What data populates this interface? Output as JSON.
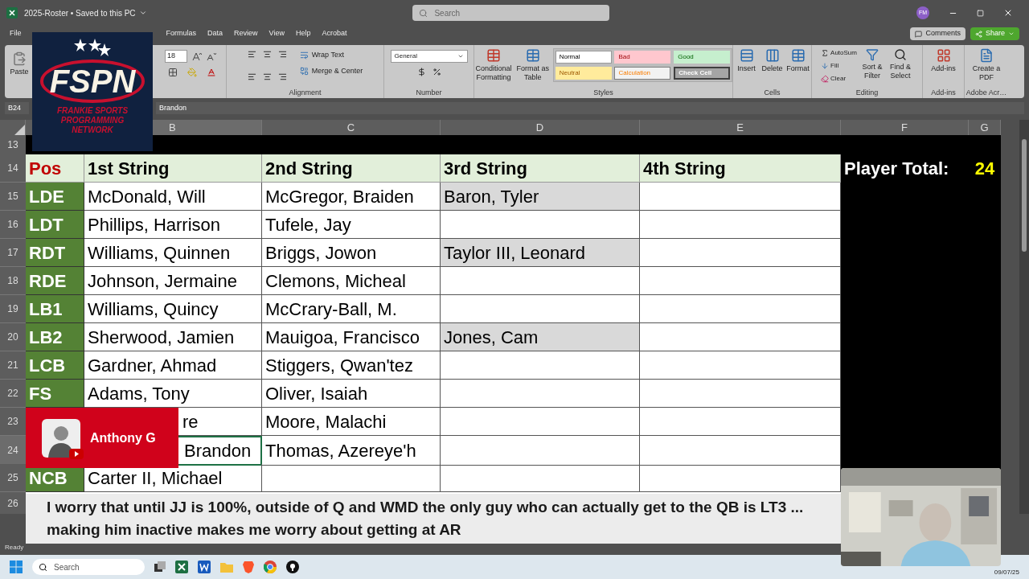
{
  "window": {
    "title": "2025-Roster • Saved to this PC",
    "search_placeholder": "Search",
    "user_initials": "FM"
  },
  "menu_tabs": [
    "File",
    "Formulas",
    "Data",
    "Review",
    "View",
    "Help",
    "Acrobat"
  ],
  "header_buttons": {
    "comments": "Comments",
    "share": "Share"
  },
  "ribbon": {
    "paste": "Paste",
    "font_size": "18",
    "alignment": {
      "wrap": "Wrap Text",
      "merge": "Merge & Center",
      "label": "Alignment"
    },
    "number": {
      "format": "General",
      "label": "Number"
    },
    "styles": {
      "conditional": "Conditional Formatting",
      "format_table": "Format as Table",
      "label": "Styles",
      "cells": [
        {
          "label": "Normal",
          "kind": "normal"
        },
        {
          "label": "Bad",
          "kind": "bad"
        },
        {
          "label": "Good",
          "kind": "good"
        },
        {
          "label": "Neutral",
          "kind": "neutral"
        },
        {
          "label": "Calculation",
          "kind": "calculation"
        },
        {
          "label": "Check Cell",
          "kind": "check"
        }
      ]
    },
    "cells": {
      "buttons": [
        "Insert",
        "Delete",
        "Format"
      ],
      "label": "Cells"
    },
    "editing": {
      "autosum": "AutoSum",
      "fill": "Fill",
      "clear": "Clear",
      "sort": "Sort & Filter",
      "find": "Find & Select",
      "label": "Editing"
    },
    "addins": {
      "button": "Add-ins",
      "label": "Add-ins"
    },
    "adobe": {
      "button": "Create a PDF",
      "label": "Adobe Acr…"
    }
  },
  "formula_bar": {
    "name_box": "B24",
    "value": "Brandon"
  },
  "columns": [
    "B",
    "C",
    "D",
    "E",
    "F",
    "G"
  ],
  "header_row": {
    "num": "14",
    "pos": "Pos",
    "first": "1st String",
    "second": "2nd String",
    "third": "3rd String",
    "fourth": "4th String",
    "total_label": "Player Total:",
    "total": "24"
  },
  "rows": [
    {
      "num": "15",
      "pos": "LDE",
      "first": "McDonald, Will",
      "second": "McGregor, Braiden",
      "third": "Baron, Tyler",
      "selected": false
    },
    {
      "num": "16",
      "pos": "LDT",
      "first": "Phillips, Harrison",
      "second": "Tufele, Jay",
      "selected": false
    },
    {
      "num": "17",
      "pos": "RDT",
      "first": "Williams, Quinnen",
      "second": "Briggs, Jowon",
      "third": "Taylor III, Leonard",
      "selected": false
    },
    {
      "num": "18",
      "pos": "RDE",
      "first": "Johnson, Jermaine",
      "second": "Clemons, Micheal",
      "selected": false
    },
    {
      "num": "19",
      "pos": "LB1",
      "first": "Williams, Quincy",
      "second": "McCrary-Ball, M.",
      "selected": false
    },
    {
      "num": "20",
      "pos": "LB2",
      "first": "Sherwood, Jamien",
      "second": "Mauigoa, Francisco",
      "third": "Jones, Cam",
      "selected": false
    },
    {
      "num": "21",
      "pos": "LCB",
      "first": "Gardner, Ahmad",
      "second": "Stiggers, Qwan'tez",
      "selected": false
    },
    {
      "num": "22",
      "pos": "FS",
      "first": "Adams, Tony",
      "second": "Oliver, Isaiah",
      "selected": false
    },
    {
      "num": "23",
      "first": "re",
      "second": "Moore, Malachi",
      "selected": false
    },
    {
      "num": "24",
      "first": "Brandon",
      "second": "Thomas, Azereye'h",
      "selected": true
    },
    {
      "num": "25",
      "pos": "NCB",
      "first": "Carter II, Michael",
      "selected": false
    }
  ],
  "extra_row_numbers": [
    "13",
    "26"
  ],
  "status_bar": {
    "text": "Ready"
  },
  "logo": {
    "title": "FSPN",
    "subtitle": "FRANKIE SPORTS PROGRAMMING NETWORK"
  },
  "chat": {
    "name": "Anthony G"
  },
  "caption": "I worry that until JJ is 100%, outside of Q and WMD the only guy who can actually get to the QB is LT3 ... making him inactive makes me worry about getting at AR",
  "taskbar": {
    "search_placeholder": "Search",
    "date": "09/07/25"
  }
}
